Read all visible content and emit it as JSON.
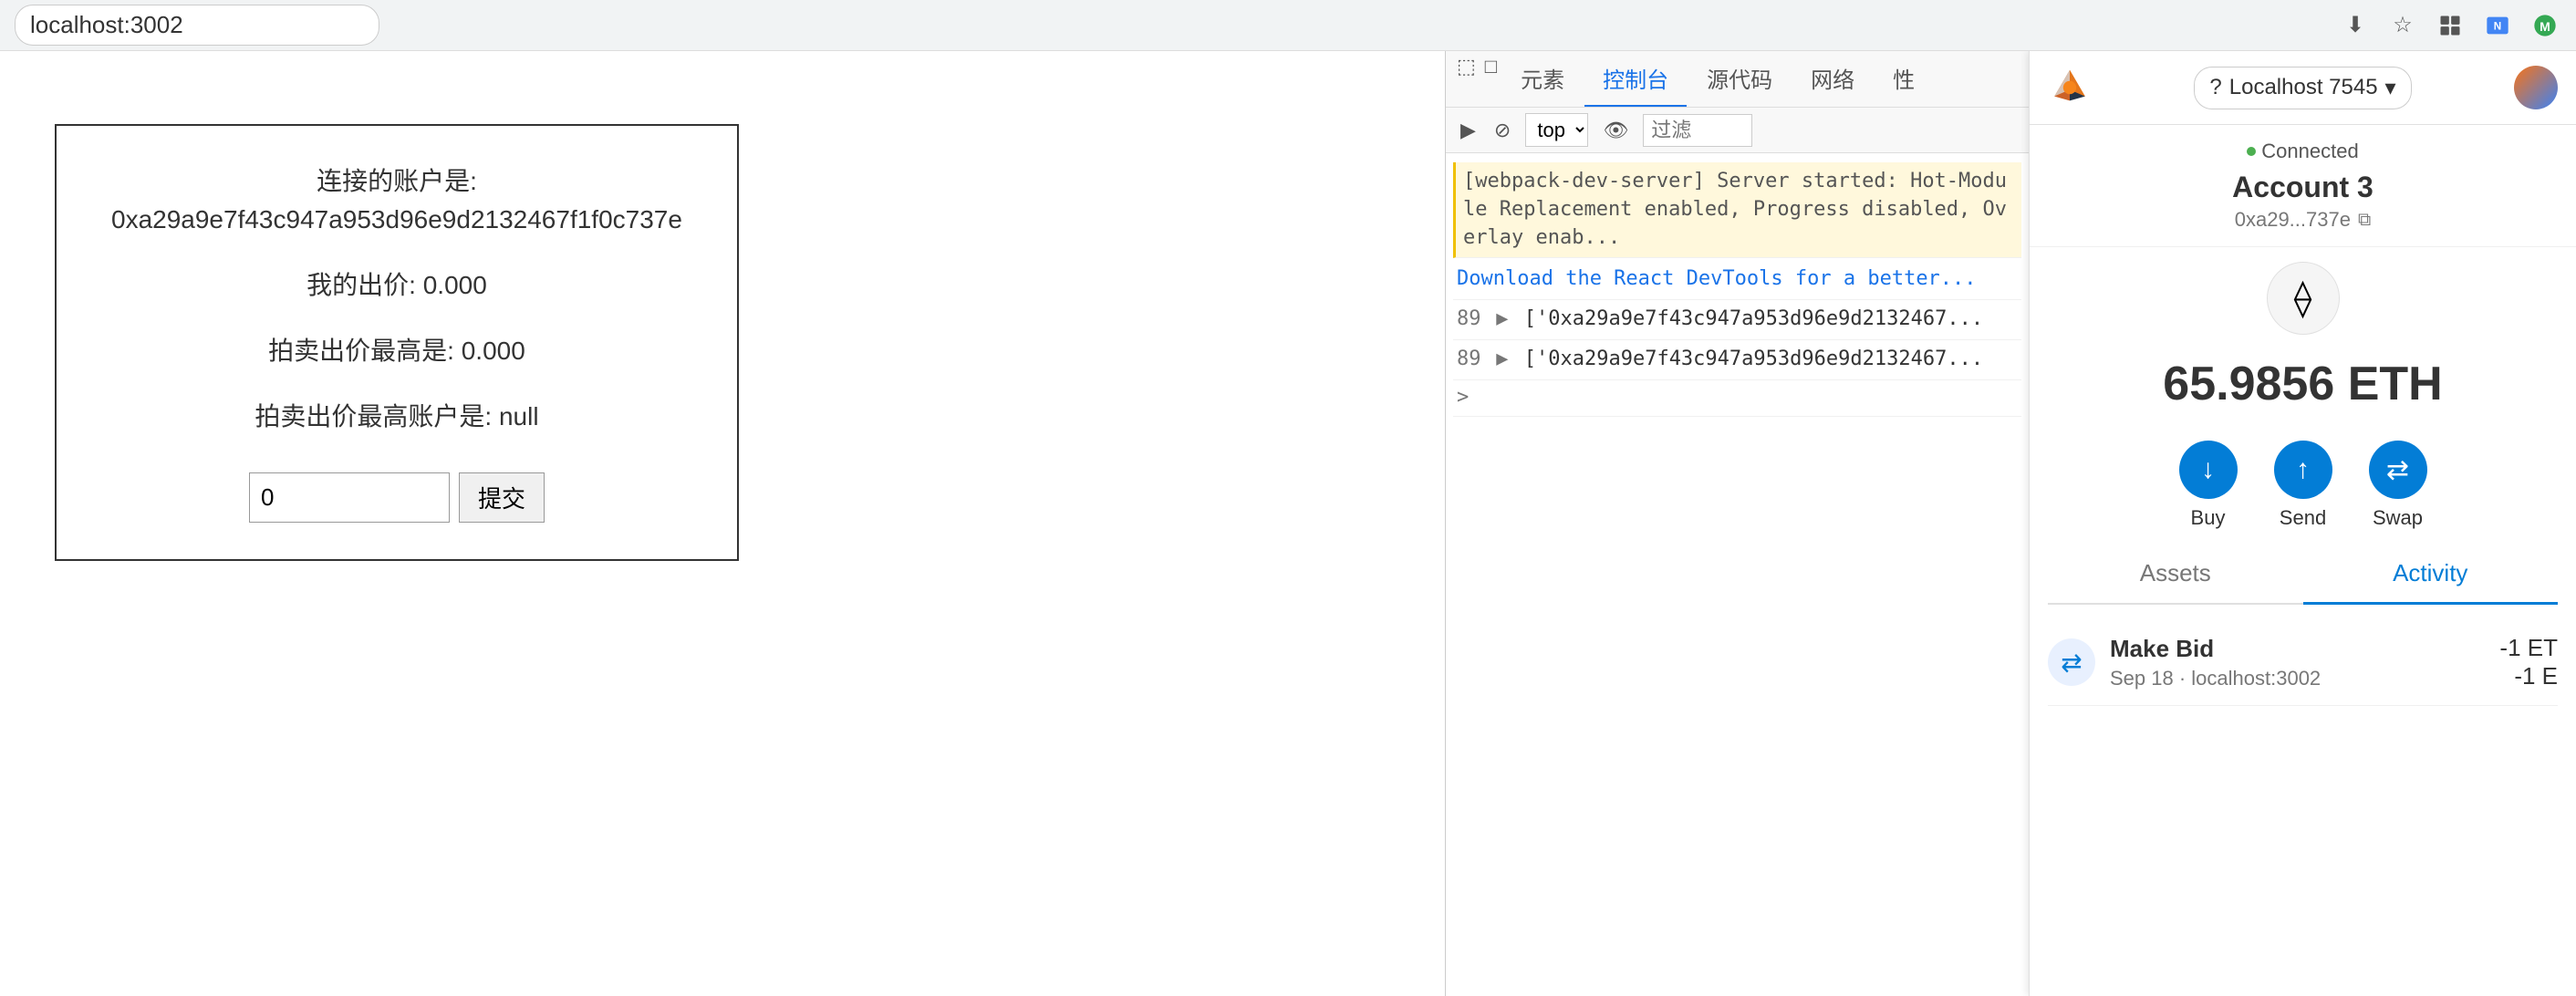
{
  "browser": {
    "url": "localhost:3002",
    "icons": [
      "bookmark",
      "star",
      "extension",
      "extension2",
      "extension3"
    ]
  },
  "devtools": {
    "tabs": [
      {
        "label": "元素",
        "active": false
      },
      {
        "label": "控制台",
        "active": true
      },
      {
        "label": "源代码",
        "active": false
      },
      {
        "label": "网络",
        "active": false
      },
      {
        "label": "性",
        "active": false
      }
    ],
    "toolbar": {
      "top_label": "top",
      "filter_placeholder": "过滤"
    },
    "console_lines": [
      {
        "type": "info",
        "text": "[webpack-dev-server] Server started: Hot-Module Replacement enabled, Progress disabled, Overlay enab..."
      },
      {
        "type": "download",
        "text": "Download the React DevTools for a better..."
      },
      {
        "type": "log",
        "num": "89",
        "arrow": "▶",
        "text": "['0xa29a9e7f43c947a953d96e9d2132467..."
      },
      {
        "type": "log",
        "num": "89",
        "arrow": "▶",
        "text": "['0xa29a9e7f43c947a953d96e9d2132467..."
      },
      {
        "type": "prompt",
        "text": ">"
      }
    ]
  },
  "webpage": {
    "connected_account_label": "连接的账户是:",
    "connected_address": "0xa29a9e7f43c947a953d96e9d2132467f1f0c737e",
    "my_bid_label": "我的出价: 0.000",
    "highest_bid_label": "拍卖出价最高是: 0.000",
    "highest_bidder_label": "拍卖出价最高账户是: null",
    "input_value": "0",
    "submit_label": "提交"
  },
  "metamask": {
    "network": "Localhost 7545",
    "account_name": "Account 3",
    "account_address": "0xa29...737e",
    "balance": "65.9856 ETH",
    "connected_label": "Connected",
    "buttons": [
      {
        "label": "Buy",
        "icon": "↓"
      },
      {
        "label": "Send",
        "icon": "↑"
      },
      {
        "label": "Swap",
        "icon": "⇄"
      }
    ],
    "tabs": [
      {
        "label": "Assets",
        "active": false
      },
      {
        "label": "Activity",
        "active": true
      }
    ],
    "activity": [
      {
        "name": "Make Bid",
        "meta": "Sep 18 · localhost:3002",
        "amount": "-1 ET",
        "amount2": "-1 E"
      }
    ]
  }
}
